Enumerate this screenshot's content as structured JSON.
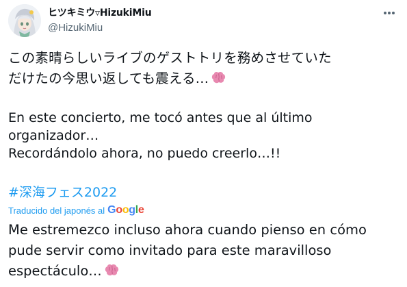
{
  "author": {
    "display_name": "ヒツキミウ▿HizukiMiu",
    "handle": "@HizukiMiu",
    "avatar_icon": "avatar-icon"
  },
  "menu": {
    "icon": "more-icon"
  },
  "tweet": {
    "jp_line1": "この素晴らしいライブのゲストトリを務めさせていた",
    "jp_line2": "だけたの今思い返しても震える…",
    "es_line1": "En este concierto, me tocó antes que al último",
    "es_line2": "organizador…",
    "es_line3": "Recordándolo ahora, no puedo creerlo…!!",
    "hashtag": "#深海フェス2022",
    "translated_label": "Traducido del japonés al",
    "translation_brand": "Google",
    "tr_line1": "Me estremezco incluso ahora cuando pienso en cómo",
    "tr_line2": "pude servir como invitado para este maravilloso",
    "tr_line3": "espectáculo…",
    "emoji": "brain-emoji"
  },
  "colors": {
    "link": "#1d9bf0",
    "text": "#0f1419",
    "muted": "#536471",
    "emoji": "#e889b0"
  }
}
